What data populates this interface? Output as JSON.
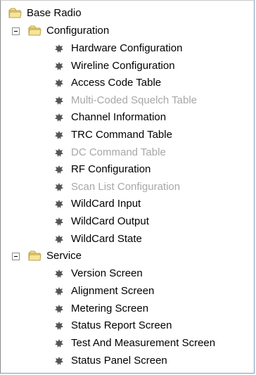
{
  "tree": {
    "root": {
      "label": "Base Radio",
      "icon": "folder-icon"
    },
    "configuration": {
      "label": "Configuration",
      "icon": "folder-icon",
      "expanded": true,
      "items": [
        {
          "label": "Hardware Configuration",
          "enabled": true
        },
        {
          "label": "Wireline Configuration",
          "enabled": true
        },
        {
          "label": "Access Code Table",
          "enabled": true
        },
        {
          "label": "Multi-Coded Squelch Table",
          "enabled": false
        },
        {
          "label": "Channel Information",
          "enabled": true
        },
        {
          "label": "TRC Command Table",
          "enabled": true
        },
        {
          "label": "DC Command Table",
          "enabled": false
        },
        {
          "label": "RF Configuration",
          "enabled": true
        },
        {
          "label": "Scan List Configuration",
          "enabled": false
        },
        {
          "label": "WildCard Input",
          "enabled": true
        },
        {
          "label": "WildCard Output",
          "enabled": true
        },
        {
          "label": "WildCard State",
          "enabled": true
        }
      ]
    },
    "service": {
      "label": "Service",
      "icon": "folder-icon",
      "expanded": true,
      "items": [
        {
          "label": "Version Screen",
          "enabled": true
        },
        {
          "label": "Alignment Screen",
          "enabled": true
        },
        {
          "label": "Metering Screen",
          "enabled": true
        },
        {
          "label": "Status Report Screen",
          "enabled": true
        },
        {
          "label": "Test And Measurement Screen",
          "enabled": true
        },
        {
          "label": "Status Panel Screen",
          "enabled": true
        }
      ]
    }
  },
  "colors": {
    "text": "#000000",
    "disabled_text": "#a7a7a7",
    "folder": "#f2d77a",
    "bullet": "#555555"
  }
}
